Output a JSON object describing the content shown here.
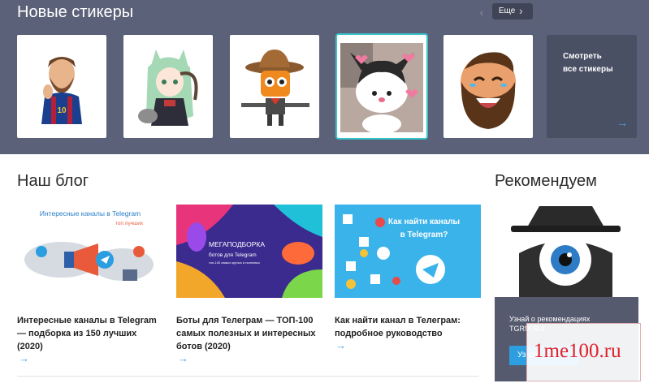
{
  "stickers": {
    "title": "Новые стикеры",
    "nav": {
      "prev_icon": "chevron-left-icon",
      "more_label": "Еще",
      "more_icon": "chevron-right-icon"
    },
    "items": [
      {
        "name": "Messi sticker",
        "selected": false
      },
      {
        "name": "Anime catgirl sticker",
        "selected": false
      },
      {
        "name": "Cowboy cat sticker",
        "selected": false
      },
      {
        "name": "Kuromi sticker",
        "selected": true
      },
      {
        "name": "Laughing bearded man sticker",
        "selected": false
      }
    ],
    "see_all": {
      "line1": "Смотреть",
      "line2": "все стикеры",
      "arrow": "→"
    }
  },
  "blog": {
    "title": "Наш блог",
    "posts": [
      {
        "image_text_1": "Интересные каналы в Telegram",
        "image_text_2": "топ лучших",
        "title_lines": [
          "Интересные каналы в Telegram",
          "— подборка из 150 лучших",
          "(2020)"
        ],
        "arrow": "→"
      },
      {
        "image_text_1": "МЕГАПОДБОРКА",
        "image_text_2": "ботов для Telegram",
        "image_text_3": "топ-100 самых крутых и полезных",
        "title_lines": [
          "Боты для Телеграм — ТОП-100",
          "самых полезных и интересных",
          "ботов (2020)"
        ],
        "arrow": "→"
      },
      {
        "image_text_1": "Как найти каналы",
        "image_text_2": "в Telegram?",
        "title_lines": [
          "Как найти канал в Телеграм:",
          "подробное руководство"
        ],
        "arrow": "→"
      }
    ]
  },
  "recommend": {
    "title": "Рекомендуем",
    "text_line1": "Узнай о рекомендациях",
    "text_line2": "TGRM.SU!",
    "button_label": "Узнать"
  },
  "watermark": {
    "text": "1me100.ru"
  },
  "colors": {
    "band": "#5b6178",
    "accent": "#3fa6e5",
    "selected_border": "#39c2c9",
    "watermark": "#e0202a"
  }
}
